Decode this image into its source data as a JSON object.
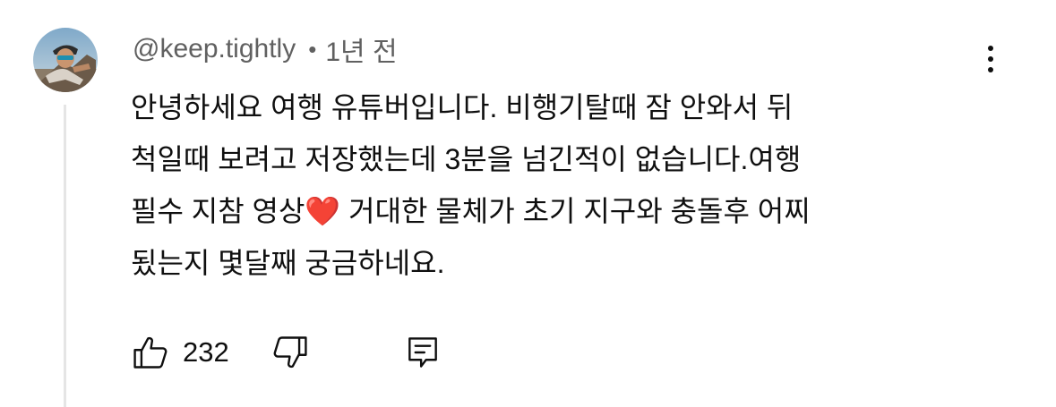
{
  "comment": {
    "author": "@keep.tightly",
    "separator": "•",
    "time_ago": "1년 전",
    "lines": [
      "안녕하세요 여행 유튜버입니다. 비행기탈때 잠 안와서 뒤",
      "척일때 보려고 저장했는데 3분을 넘긴적이 없습니다.여행",
      "필수 지참 영상",
      "❤️",
      " 거대한 물체가 초기 지구와 충돌후 어찌",
      "됬는지 몇달째 궁금하네요."
    ],
    "like_count": "232"
  },
  "icons": {
    "avatar": "avatar-photo",
    "more": "more-vert-icon",
    "like": "thumb-up-icon",
    "dislike": "thumb-down-icon",
    "reply": "reply-comment-icon"
  },
  "colors": {
    "text": "#0f0f0f",
    "meta": "#606060",
    "thread_line": "#e5e5e5",
    "heart": "#e8202a"
  }
}
